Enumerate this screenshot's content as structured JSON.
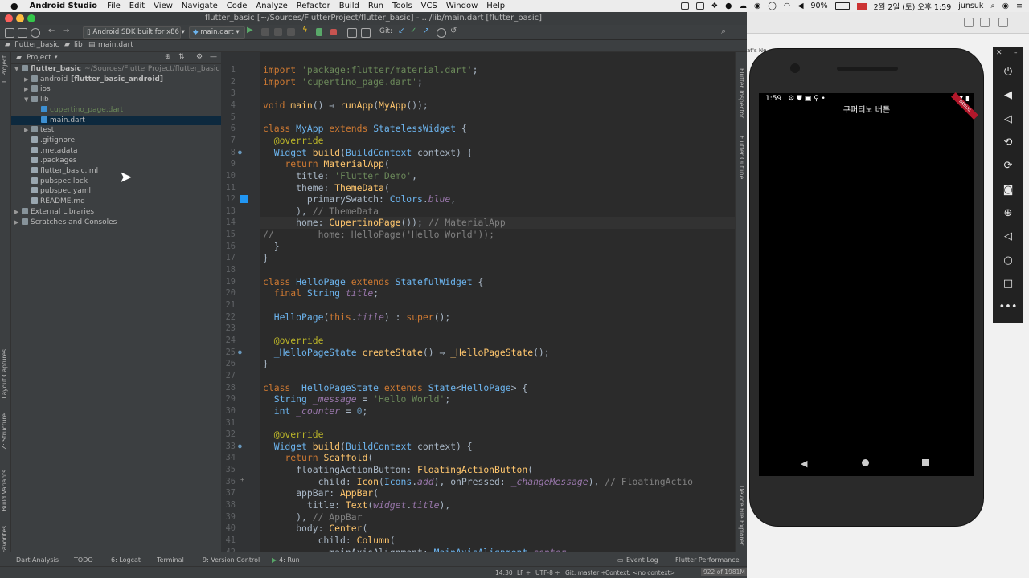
{
  "menubar": {
    "app_name": "Android Studio",
    "items": [
      "File",
      "Edit",
      "View",
      "Navigate",
      "Code",
      "Analyze",
      "Refactor",
      "Build",
      "Run",
      "Tools",
      "VCS",
      "Window",
      "Help"
    ],
    "battery": "90%",
    "datetime": "2월 2일 (토) 오후 1:59",
    "user": "junsuk"
  },
  "window_title": "flutter_basic [~/Sources/FlutterProject/flutter_basic] - .../lib/main.dart [flutter_basic]",
  "toolbar": {
    "device": "Android SDK built for x86",
    "run_config": "main.dart",
    "git_label": "Git:"
  },
  "breadcrumb": [
    "flutter_basic",
    "lib",
    "main.dart"
  ],
  "project_panel": {
    "title": "Project",
    "tree": [
      {
        "label": "flutter_basic",
        "suffix": "~/Sources/FlutterProject/flutter_basic",
        "depth": 0,
        "arrow": "open",
        "bold": true
      },
      {
        "label": "android",
        "suffix": "[flutter_basic_android]",
        "depth": 1,
        "arrow": "closed",
        "bold": false
      },
      {
        "label": "ios",
        "suffix": "",
        "depth": 1,
        "arrow": "closed",
        "bold": false
      },
      {
        "label": "lib",
        "suffix": "",
        "depth": 1,
        "arrow": "open",
        "bold": false
      },
      {
        "label": "cupertino_page.dart",
        "suffix": "",
        "depth": 2,
        "arrow": "none",
        "bold": false,
        "color": "#6a8759"
      },
      {
        "label": "main.dart",
        "suffix": "",
        "depth": 2,
        "arrow": "none",
        "bold": false,
        "selected": true
      },
      {
        "label": "test",
        "suffix": "",
        "depth": 1,
        "arrow": "closed",
        "bold": false
      },
      {
        "label": ".gitignore",
        "suffix": "",
        "depth": 1,
        "arrow": "none",
        "bold": false
      },
      {
        "label": ".metadata",
        "suffix": "",
        "depth": 1,
        "arrow": "none",
        "bold": false
      },
      {
        "label": ".packages",
        "suffix": "",
        "depth": 1,
        "arrow": "none",
        "bold": false
      },
      {
        "label": "flutter_basic.iml",
        "suffix": "",
        "depth": 1,
        "arrow": "none",
        "bold": false
      },
      {
        "label": "pubspec.lock",
        "suffix": "",
        "depth": 1,
        "arrow": "none",
        "bold": false
      },
      {
        "label": "pubspec.yaml",
        "suffix": "",
        "depth": 1,
        "arrow": "none",
        "bold": false
      },
      {
        "label": "README.md",
        "suffix": "",
        "depth": 1,
        "arrow": "none",
        "bold": false
      },
      {
        "label": "External Libraries",
        "suffix": "",
        "depth": 0,
        "arrow": "closed",
        "bold": false
      },
      {
        "label": "Scratches and Consoles",
        "suffix": "",
        "depth": 0,
        "arrow": "closed",
        "bold": false
      }
    ]
  },
  "left_tool_tabs": [
    "1: Project",
    "Layout Captures",
    "Z: Structure",
    "Build Variants",
    "2: Favorites"
  ],
  "right_tool_tabs": [
    "Flutter Inspector",
    "Flutter Outline",
    "Device File Explorer"
  ],
  "code_lines": [
    [
      [
        "kw",
        "import "
      ],
      [
        "st",
        "'package:flutter/material.dart'"
      ],
      [
        "",
        "; "
      ]
    ],
    [
      [
        "kw",
        "import "
      ],
      [
        "st",
        "'cupertino_page.dart'"
      ],
      [
        "",
        ";"
      ]
    ],
    [],
    [
      [
        "kw",
        "void "
      ],
      [
        "fn",
        "main"
      ],
      [
        "",
        "() ⇒ "
      ],
      [
        "fn",
        "runApp"
      ],
      [
        "",
        "("
      ],
      [
        "fn",
        "MyApp"
      ],
      [
        "",
        "());"
      ]
    ],
    [],
    [
      [
        "kw",
        "class "
      ],
      [
        "bl",
        "MyApp "
      ],
      [
        "kw",
        "extends "
      ],
      [
        "bl",
        "StatelessWidget "
      ],
      [
        "",
        "{"
      ]
    ],
    [
      [
        "",
        "  "
      ],
      [
        "an",
        "@override"
      ]
    ],
    [
      [
        "",
        "  "
      ],
      [
        "bl",
        "Widget "
      ],
      [
        "fn",
        "build"
      ],
      [
        "",
        "("
      ],
      [
        "bl",
        "BuildContext "
      ],
      [
        "",
        "context) {"
      ]
    ],
    [
      [
        "",
        "    "
      ],
      [
        "kw",
        "return "
      ],
      [
        "fn",
        "MaterialApp"
      ],
      [
        "",
        "("
      ]
    ],
    [
      [
        "",
        "      title: "
      ],
      [
        "st",
        "'Flutter Demo'"
      ],
      [
        "",
        ","
      ]
    ],
    [
      [
        "",
        "      theme: "
      ],
      [
        "fn",
        "ThemeData"
      ],
      [
        "",
        "("
      ]
    ],
    [
      [
        "",
        "        primarySwatch: "
      ],
      [
        "bl",
        "Colors"
      ],
      [
        "",
        "."
      ],
      [
        "fl",
        "blue"
      ],
      [
        "",
        ","
      ]
    ],
    [
      [
        "",
        "      ), "
      ],
      [
        "cm",
        "// ThemeData"
      ]
    ],
    [
      [
        "",
        "      home: "
      ],
      [
        "fn",
        "CupertinoPage"
      ],
      [
        "",
        "()); "
      ],
      [
        "cm",
        "// MaterialApp"
      ]
    ],
    [
      [
        "cm",
        "//        home: HelloPage('Hello World'));"
      ]
    ],
    [
      [
        "",
        "  }"
      ]
    ],
    [
      [
        "",
        "}"
      ]
    ],
    [],
    [
      [
        "kw",
        "class "
      ],
      [
        "bl",
        "HelloPage "
      ],
      [
        "kw",
        "extends "
      ],
      [
        "bl",
        "StatefulWidget "
      ],
      [
        "",
        "{"
      ]
    ],
    [
      [
        "",
        "  "
      ],
      [
        "kw",
        "final "
      ],
      [
        "bl",
        "String "
      ],
      [
        "fl",
        "title"
      ],
      [
        "",
        ";"
      ]
    ],
    [],
    [
      [
        "",
        "  "
      ],
      [
        "bl",
        "HelloPage"
      ],
      [
        "",
        "("
      ],
      [
        "kw",
        "this"
      ],
      [
        "",
        "."
      ],
      [
        "fl",
        "title"
      ],
      [
        "",
        ") : "
      ],
      [
        "kw",
        "super"
      ],
      [
        "",
        "();"
      ]
    ],
    [],
    [
      [
        "",
        "  "
      ],
      [
        "an",
        "@override"
      ]
    ],
    [
      [
        "",
        "  "
      ],
      [
        "bl",
        "_HelloPageState "
      ],
      [
        "fn",
        "createState"
      ],
      [
        "",
        "() ⇒ "
      ],
      [
        "fn",
        "_HelloPageState"
      ],
      [
        "",
        "();"
      ]
    ],
    [
      [
        "",
        "}"
      ]
    ],
    [],
    [
      [
        "kw",
        "class "
      ],
      [
        "bl",
        "_HelloPageState "
      ],
      [
        "kw",
        "extends "
      ],
      [
        "bl",
        "State"
      ],
      [
        "",
        "<"
      ],
      [
        "bl",
        "HelloPage"
      ],
      [
        "",
        "> {"
      ]
    ],
    [
      [
        "",
        "  "
      ],
      [
        "bl",
        "String "
      ],
      [
        "fl",
        "_message "
      ],
      [
        "",
        "= "
      ],
      [
        "st",
        "'Hello World'"
      ],
      [
        "",
        ";"
      ]
    ],
    [
      [
        "",
        "  "
      ],
      [
        "bl",
        "int "
      ],
      [
        "fl",
        "_counter "
      ],
      [
        "",
        "= "
      ],
      [
        "nm",
        "0"
      ],
      [
        "",
        ";"
      ]
    ],
    [],
    [
      [
        "",
        "  "
      ],
      [
        "an",
        "@override"
      ]
    ],
    [
      [
        "",
        "  "
      ],
      [
        "bl",
        "Widget "
      ],
      [
        "fn",
        "build"
      ],
      [
        "",
        "("
      ],
      [
        "bl",
        "BuildContext "
      ],
      [
        "",
        "context) {"
      ]
    ],
    [
      [
        "",
        "    "
      ],
      [
        "kw",
        "return "
      ],
      [
        "fn",
        "Scaffold"
      ],
      [
        "",
        "("
      ]
    ],
    [
      [
        "",
        "      floatingActionButton: "
      ],
      [
        "fn",
        "FloatingActionButton"
      ],
      [
        "",
        "("
      ]
    ],
    [
      [
        "",
        "          child: "
      ],
      [
        "fn",
        "Icon"
      ],
      [
        "",
        "("
      ],
      [
        "bl",
        "Icons"
      ],
      [
        "",
        "."
      ],
      [
        "fl",
        "add"
      ],
      [
        "",
        "), onPressed: "
      ],
      [
        "fl",
        "_changeMessage"
      ],
      [
        "",
        "), "
      ],
      [
        "cm",
        "// FloatingActio"
      ]
    ],
    [
      [
        "",
        "      appBar: "
      ],
      [
        "fn",
        "AppBar"
      ],
      [
        "",
        "("
      ]
    ],
    [
      [
        "",
        "        title: "
      ],
      [
        "fn",
        "Text"
      ],
      [
        "",
        "("
      ],
      [
        "fl",
        "widget"
      ],
      [
        "",
        "."
      ],
      [
        "fl",
        "title"
      ],
      [
        "",
        "),"
      ]
    ],
    [
      [
        "",
        "      ), "
      ],
      [
        "cm",
        "// AppBar"
      ]
    ],
    [
      [
        "",
        "      body: "
      ],
      [
        "fn",
        "Center"
      ],
      [
        "",
        "("
      ]
    ],
    [
      [
        "",
        "          child: "
      ],
      [
        "fn",
        "Column"
      ],
      [
        "",
        "("
      ]
    ],
    [
      [
        "",
        "            mainAxisAlignment: "
      ],
      [
        "bl",
        "MainAxisAlignment"
      ],
      [
        "",
        "."
      ],
      [
        "fl",
        "center"
      ],
      [
        "",
        ","
      ]
    ],
    [
      [
        "",
        "            "
      ]
    ]
  ],
  "bottom_tools": [
    "Dart Analysis",
    "TODO",
    "6: Logcat",
    "Terminal",
    "9: Version Control",
    "4: Run",
    "Event Log",
    "Flutter Performance"
  ],
  "status_bar": {
    "position": "14:30",
    "line_sep": "LF ÷",
    "encoding": "UTF-8 ÷",
    "branch": "Git: master ÷",
    "context": "Context: <no context>",
    "memory": "922 of 1981M"
  },
  "emulator": {
    "time": "1:59",
    "app_title": "쿠퍼티노 버튼",
    "debug_banner": "DEBUG"
  },
  "browser_fragment": "at's Ne"
}
